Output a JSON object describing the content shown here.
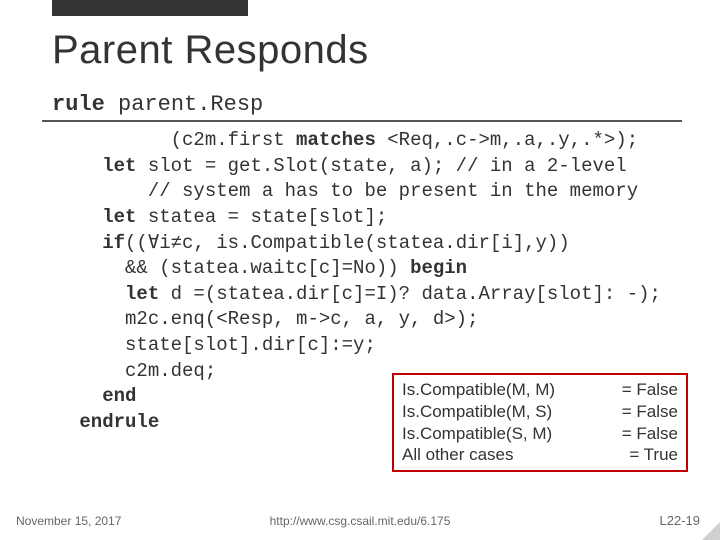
{
  "title": "Parent Responds",
  "rule_kw": "rule",
  "rule_name": " parent.Resp",
  "code": {
    "l1_a": "         (c2m.first ",
    "l1_kw": "matches",
    "l1_b": " <Req,.c->m,.a,.y,.*>);",
    "l2_kw": "   let",
    "l2_b": " slot = get.Slot(state, a); // in a 2-level",
    "l3": "       // system a has to be present in the memory",
    "l4_kw": "   let",
    "l4_b": " statea = state[slot];",
    "l5_kw": "   if",
    "l5_b": "((∀i≠c, is.Compatible(statea.dir[i],y))",
    "l6_a": "     && (statea.waitc[c]=No)) ",
    "l6_kw": "begin",
    "l7_kw": "     let",
    "l7_b": " d =(statea.dir[c]=I)? data.Array[slot]: -);",
    "l8": "     m2c.enq(<Resp, m->c, a, y, d>);",
    "l9": "     state[slot].dir[c]:=y;",
    "l10": "     c2m.deq;",
    "l11_kw": "   end",
    "l12_kw": " endrule"
  },
  "box": {
    "r1_left": "Is.Compatible(M, M)",
    "r1_right": "= False",
    "r2_left": "Is.Compatible(M, S)",
    "r2_right": "= False",
    "r3_left": "Is.Compatible(S, M)",
    "r3_right": "= False",
    "r4_left": "All other cases",
    "r4_right": "= True"
  },
  "footer": {
    "date": "November 15, 2017",
    "url": "http://www.csg.csail.mit.edu/6.175",
    "page": "L22-19"
  }
}
